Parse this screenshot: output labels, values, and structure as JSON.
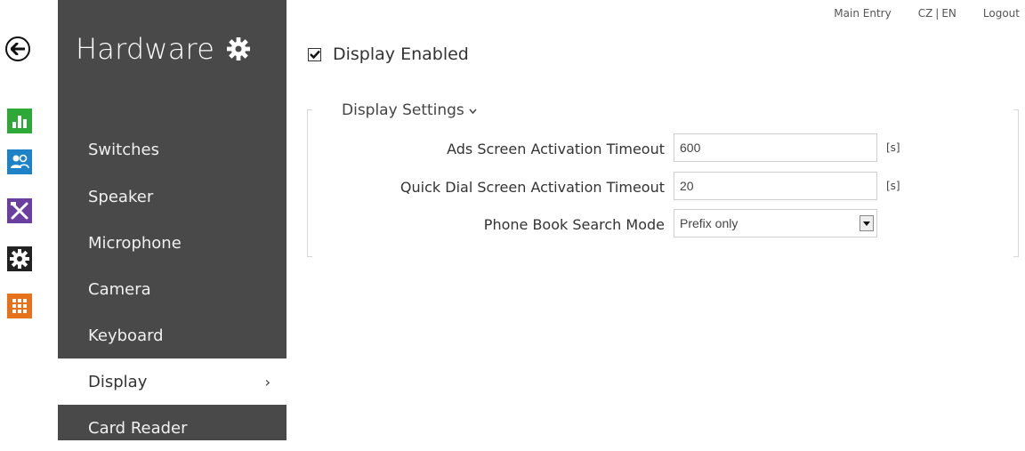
{
  "header": {
    "links": {
      "main_entry": "Main Entry",
      "lang_cz": "CZ",
      "lang_sep": "|",
      "lang_en": "EN",
      "logout": "Logout"
    }
  },
  "rail": {
    "icons": [
      "back-arrow-icon",
      "status-chart-icon",
      "users-icon",
      "tools-icon",
      "gear-icon",
      "grid-icon"
    ],
    "colors": {
      "status": "#2ea836",
      "users": "#1d83c6",
      "services": "#6b3fa0",
      "hardware": "#222222",
      "system": "#e8711c"
    }
  },
  "menu": {
    "title": "Hardware",
    "items": [
      {
        "label": "Switches"
      },
      {
        "label": "Speaker"
      },
      {
        "label": "Microphone"
      },
      {
        "label": "Camera"
      },
      {
        "label": "Keyboard"
      },
      {
        "label": "Display",
        "active": true,
        "chevron": "›"
      },
      {
        "label": "Card Reader"
      }
    ]
  },
  "content": {
    "display_enabled": {
      "label": "Display Enabled",
      "checked": true
    },
    "group": {
      "title": "Display Settings",
      "fields": [
        {
          "label": "Ads Screen Activation Timeout",
          "value": "600",
          "unit": "[s]"
        },
        {
          "label": "Quick Dial Screen Activation Timeout",
          "value": "20",
          "unit": "[s]"
        },
        {
          "label": "Phone Book Search Mode",
          "value": "Prefix only"
        }
      ]
    }
  }
}
